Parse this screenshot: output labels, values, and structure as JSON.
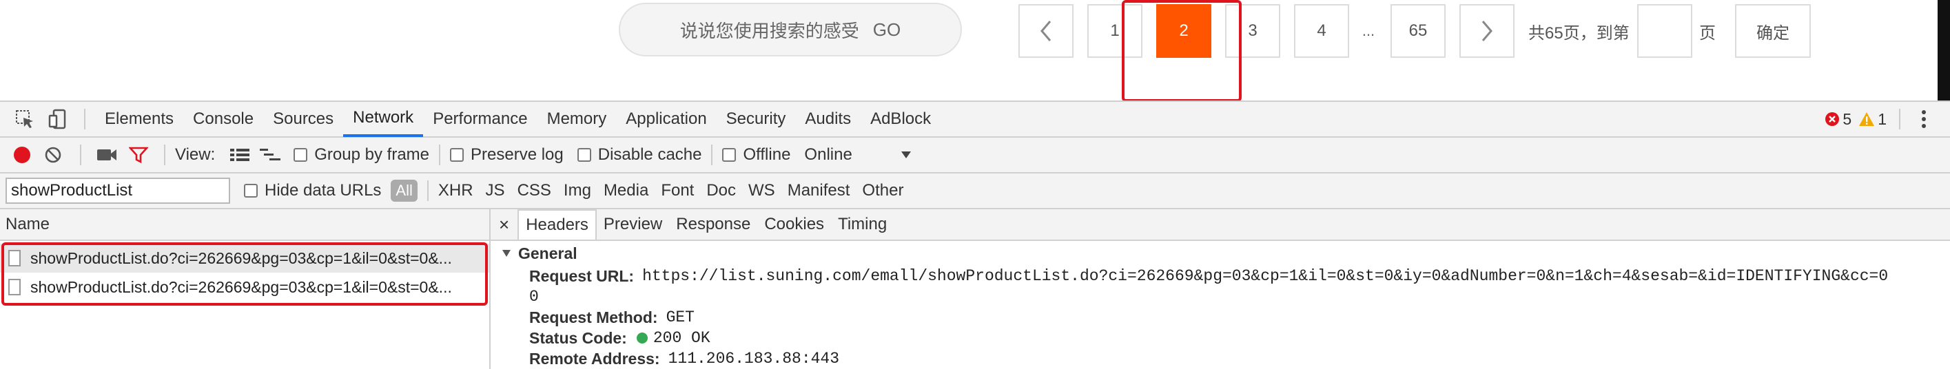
{
  "page": {
    "feedback": {
      "text": "说说您使用搜索的感受",
      "go": "GO"
    },
    "pagination": {
      "prev_icon": "chevron-left-icon",
      "next_icon": "chevron-right-icon",
      "pages": [
        "1",
        "2",
        "3",
        "4"
      ],
      "current": "2",
      "ellipsis": "...",
      "last": "65",
      "total_text": "共65页，到第",
      "page_unit": "页",
      "jump_value": "",
      "confirm": "确定"
    },
    "highlight_color": "#e0141e",
    "accent_color": "#ff5500"
  },
  "devtools": {
    "tabs": [
      "Elements",
      "Console",
      "Sources",
      "Network",
      "Performance",
      "Memory",
      "Application",
      "Security",
      "Audits",
      "AdBlock"
    ],
    "selected_tab": "Network",
    "errors": "5",
    "warnings": "1",
    "network_toolbar": {
      "view_label": "View:",
      "group_by_frame": "Group by frame",
      "preserve_log": "Preserve log",
      "disable_cache": "Disable cache",
      "offline": "Offline",
      "throttle": "Online"
    },
    "filter": {
      "value": "showProductList",
      "hide_data_urls": "Hide data URLs",
      "types": [
        "All",
        "XHR",
        "JS",
        "CSS",
        "Img",
        "Media",
        "Font",
        "Doc",
        "WS",
        "Manifest",
        "Other"
      ]
    },
    "requests": {
      "header": "Name",
      "items": [
        "showProductList.do?ci=262669&pg=03&cp=1&il=0&st=0&...",
        "showProductList.do?ci=262669&pg=03&cp=1&il=0&st=0&..."
      ]
    },
    "details": {
      "close": "×",
      "tabs": [
        "Headers",
        "Preview",
        "Response",
        "Cookies",
        "Timing"
      ],
      "section": "General",
      "request_url_label": "Request URL:",
      "request_url": "https://list.suning.com/emall/showProductList.do?ci=262669&pg=03&cp=1&il=0&st=0&iy=0&adNumber=0&n=1&ch=4&sesab=&id=IDENTIFYING&cc=0",
      "request_url_wrap": "0",
      "method_label": "Request Method:",
      "method": "GET",
      "status_label": "Status Code:",
      "status": "200 OK",
      "status_color": "#34a853",
      "remote_label": "Remote Address:",
      "remote": "111.206.183.88:443"
    }
  }
}
